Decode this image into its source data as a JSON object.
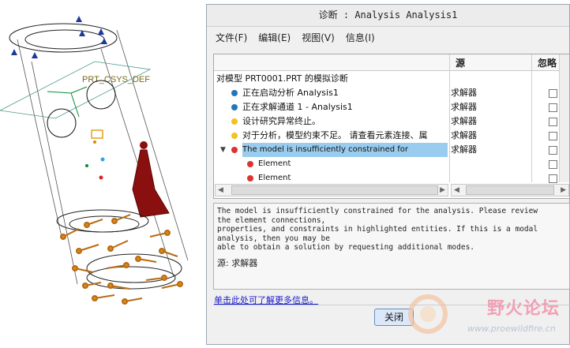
{
  "dialog": {
    "title": "诊断 : Analysis Analysis1",
    "menu": [
      "文件(F)",
      "编辑(E)",
      "视图(V)",
      "信息(I)"
    ],
    "columns": {
      "source": "源",
      "ignore": "忽略"
    },
    "rows": [
      {
        "text": "对模型 PRT0001.PRT 的模拟诊断",
        "source": "",
        "dot": "",
        "checkbox": false
      },
      {
        "text": "正在启动分析 Analysis1",
        "source": "求解器",
        "dot": "#2277bb",
        "checkbox": true
      },
      {
        "text": "正在求解通道 1 - Analysis1",
        "source": "求解器",
        "dot": "#2277bb",
        "checkbox": true
      },
      {
        "text": " 设计研究异常终止。",
        "source": "求解器",
        "dot": "#f0c419",
        "checkbox": true
      },
      {
        "text": "对于分析，模型约束不足。 请查看元素连接、属",
        "source": "求解器",
        "dot": "#f0c419",
        "checkbox": true
      },
      {
        "text": "The model is insufficiently constrained for",
        "source": "求解器",
        "dot": "#dd3333",
        "checkbox": true
      },
      {
        "text": "Element",
        "source": "",
        "dot": "#dd3333",
        "checkbox": true
      },
      {
        "text": "Element",
        "source": "",
        "dot": "#dd3333",
        "checkbox": true
      }
    ],
    "description": [
      "The model is insufficiently constrained for the analysis. Please review",
      "the element connections,",
      "properties, and constraints in highlighted entities. If this is a modal",
      "analysis, then you may be",
      "able to obtain a solution by requesting additional modes."
    ],
    "description_source": "源: 求解器",
    "help_link": "单击此处可了解更多信息。",
    "close_button": "关闭"
  },
  "viewport": {
    "csys_label": "PRT_CSYS_DEF"
  },
  "watermark": {
    "text": "野火论坛",
    "url": "www.proewildfire.cn"
  }
}
